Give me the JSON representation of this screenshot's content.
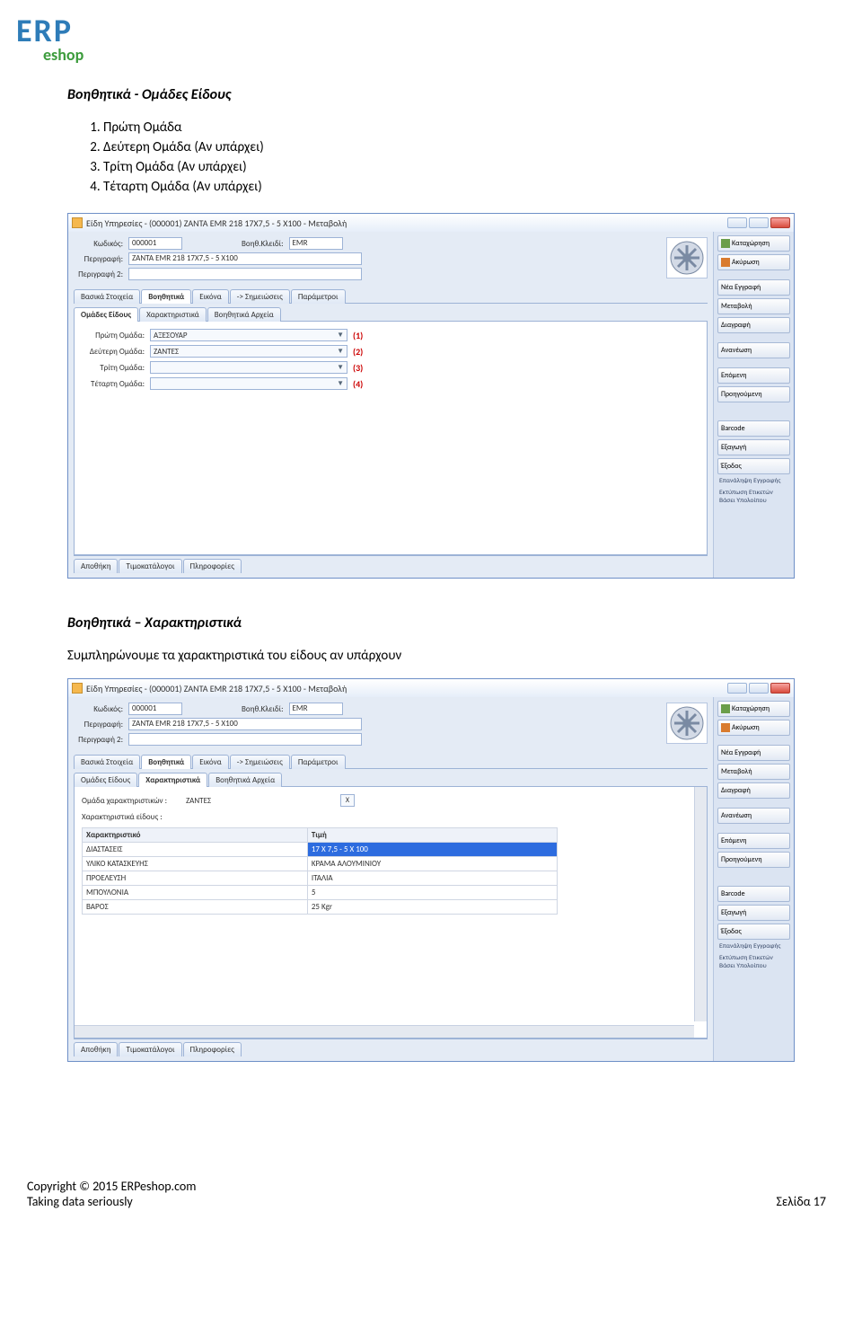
{
  "logo": {
    "line1": "ERP",
    "line2": "eshop"
  },
  "heading1": "Βοηθητικά - Ομάδες Είδους",
  "list1": [
    "Πρώτη Ομάδα",
    "Δεύτερη Ομάδα (Αν υπάρχει)",
    "Τρίτη Ομάδα (Αν υπάρχει)",
    "Τέταρτη Ομάδα (Αν υπάρχει)"
  ],
  "heading2": "Βοηθητικά – Χαρακτηριστικά",
  "body2": "Συμπληρώνουμε τα χαρακτηριστικά του είδους αν υπάρχουν",
  "window": {
    "title": "Είδη Υπηρεσίες - (000001) ZANTA EMR 218 17X7,5 - 5 X100 -  Μεταβολή",
    "code_label": "Κωδικός:",
    "code_value": "000001",
    "hkey_label": "Βοηθ.Κλειδί:",
    "hkey_value": "EMR",
    "desc_label": "Περιγραφή:",
    "desc_value": "ZANTA EMR 218 17X7,5 - 5 X100",
    "desc2_label": "Περιγραφή 2:",
    "desc2_value": "",
    "tabs": [
      "Βασικά Στοιχεία",
      "Βοηθητικά",
      "Εικόνα",
      "-> Σημειώσεις",
      "Παράμετροι"
    ],
    "subtabs": [
      "Ομάδες Είδους",
      "Χαρακτηριστικά",
      "Βοηθητικά Αρχεία"
    ],
    "groups": [
      {
        "label": "Πρώτη Ομάδα:",
        "value": "ΑΞΕΣΟΥΑΡ",
        "mark": "(1)"
      },
      {
        "label": "Δεύτερη Ομάδα:",
        "value": "ΖΑΝΤΕΣ",
        "mark": "(2)"
      },
      {
        "label": "Τρίτη Ομάδα:",
        "value": "",
        "mark": "(3)"
      },
      {
        "label": "Τέταρτη Ομάδα:",
        "value": "",
        "mark": "(4)"
      }
    ],
    "char_group_label": "Ομάδα χαρακτηριστικών :",
    "char_group_value": "ΖΑΝΤΕΣ",
    "char_list_label": "Χαρακτηριστικά είδους :",
    "char_cols": [
      "Χαρακτηριστικό",
      "Τιμή"
    ],
    "char_rows": [
      {
        "k": "ΔΙΑΣΤΑΣΕΙΣ",
        "v": "17 X 7,5 - 5 X 100",
        "sel": true
      },
      {
        "k": "ΥΛΙΚΟ ΚΑΤΑΣΚΕΥΗΣ",
        "v": "ΚΡΑΜΑ ΑΛΟΥΜΙΝΙΟΥ"
      },
      {
        "k": "ΠΡΟΕΛΕΥΣΗ",
        "v": "ΙΤΑΛΙΑ"
      },
      {
        "k": "ΜΠΟΥΛΟΝΙΑ",
        "v": "5"
      },
      {
        "k": "ΒΑΡΟΣ",
        "v": "25 Kgr"
      }
    ],
    "bottom_tabs": [
      "Αποθήκη",
      "Τιμοκατάλογοι",
      "Πληροφορίες"
    ],
    "side_buttons": [
      "Καταχώρηση",
      "Ακύρωση",
      "Νέα Εγγραφή",
      "Μεταβολή",
      "Διαγραφή",
      "Ανανέωση",
      "Επόμενη",
      "Προηγούμενη",
      "Barcode",
      "Εξαγωγή",
      "Έξοδος"
    ],
    "side_labels": [
      "Επανάληψη Εγγραφής",
      "Εκτύπωση Ετικετών Βάσει Υπολοίπου"
    ]
  },
  "footer": {
    "copyright": "Copyright © 2015 ERPeshop.com",
    "tagline": "Taking data seriously",
    "page": "Σελίδα 17"
  }
}
